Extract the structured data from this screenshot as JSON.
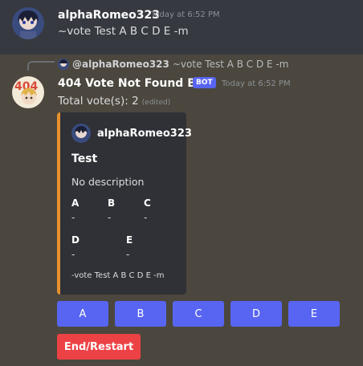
{
  "message_user": {
    "username": "alphaRomeo323",
    "timestamp": "Today at 6:52 PM",
    "content": "~vote Test A B C D E -m"
  },
  "bot_message": {
    "reply_mention": "@alphaRomeo323",
    "reply_text": "~vote Test A B C D E -m",
    "username": "404 Vote Not Found Bot",
    "badge": "BOT",
    "timestamp": "Today at 6:52 PM",
    "content": "Total vote(s): 2",
    "edited": "(edited)"
  },
  "embed": {
    "author": "alphaRomeo323",
    "title": "Test",
    "description": "No description",
    "fields": [
      {
        "name": "A",
        "value": "-"
      },
      {
        "name": "B",
        "value": "-"
      },
      {
        "name": "C",
        "value": "-"
      },
      {
        "name": "D",
        "value": "-"
      },
      {
        "name": "E",
        "value": "-"
      }
    ],
    "footer": "-vote Test A B C D E -m",
    "accent_color": "#e8912d"
  },
  "buttons": {
    "options": [
      "A",
      "B",
      "C",
      "D",
      "E"
    ],
    "end_restart": "End/Restart"
  },
  "colors": {
    "button_primary": "#5865f2",
    "button_danger": "#ed4245",
    "bot_badge": "#5865f2"
  }
}
